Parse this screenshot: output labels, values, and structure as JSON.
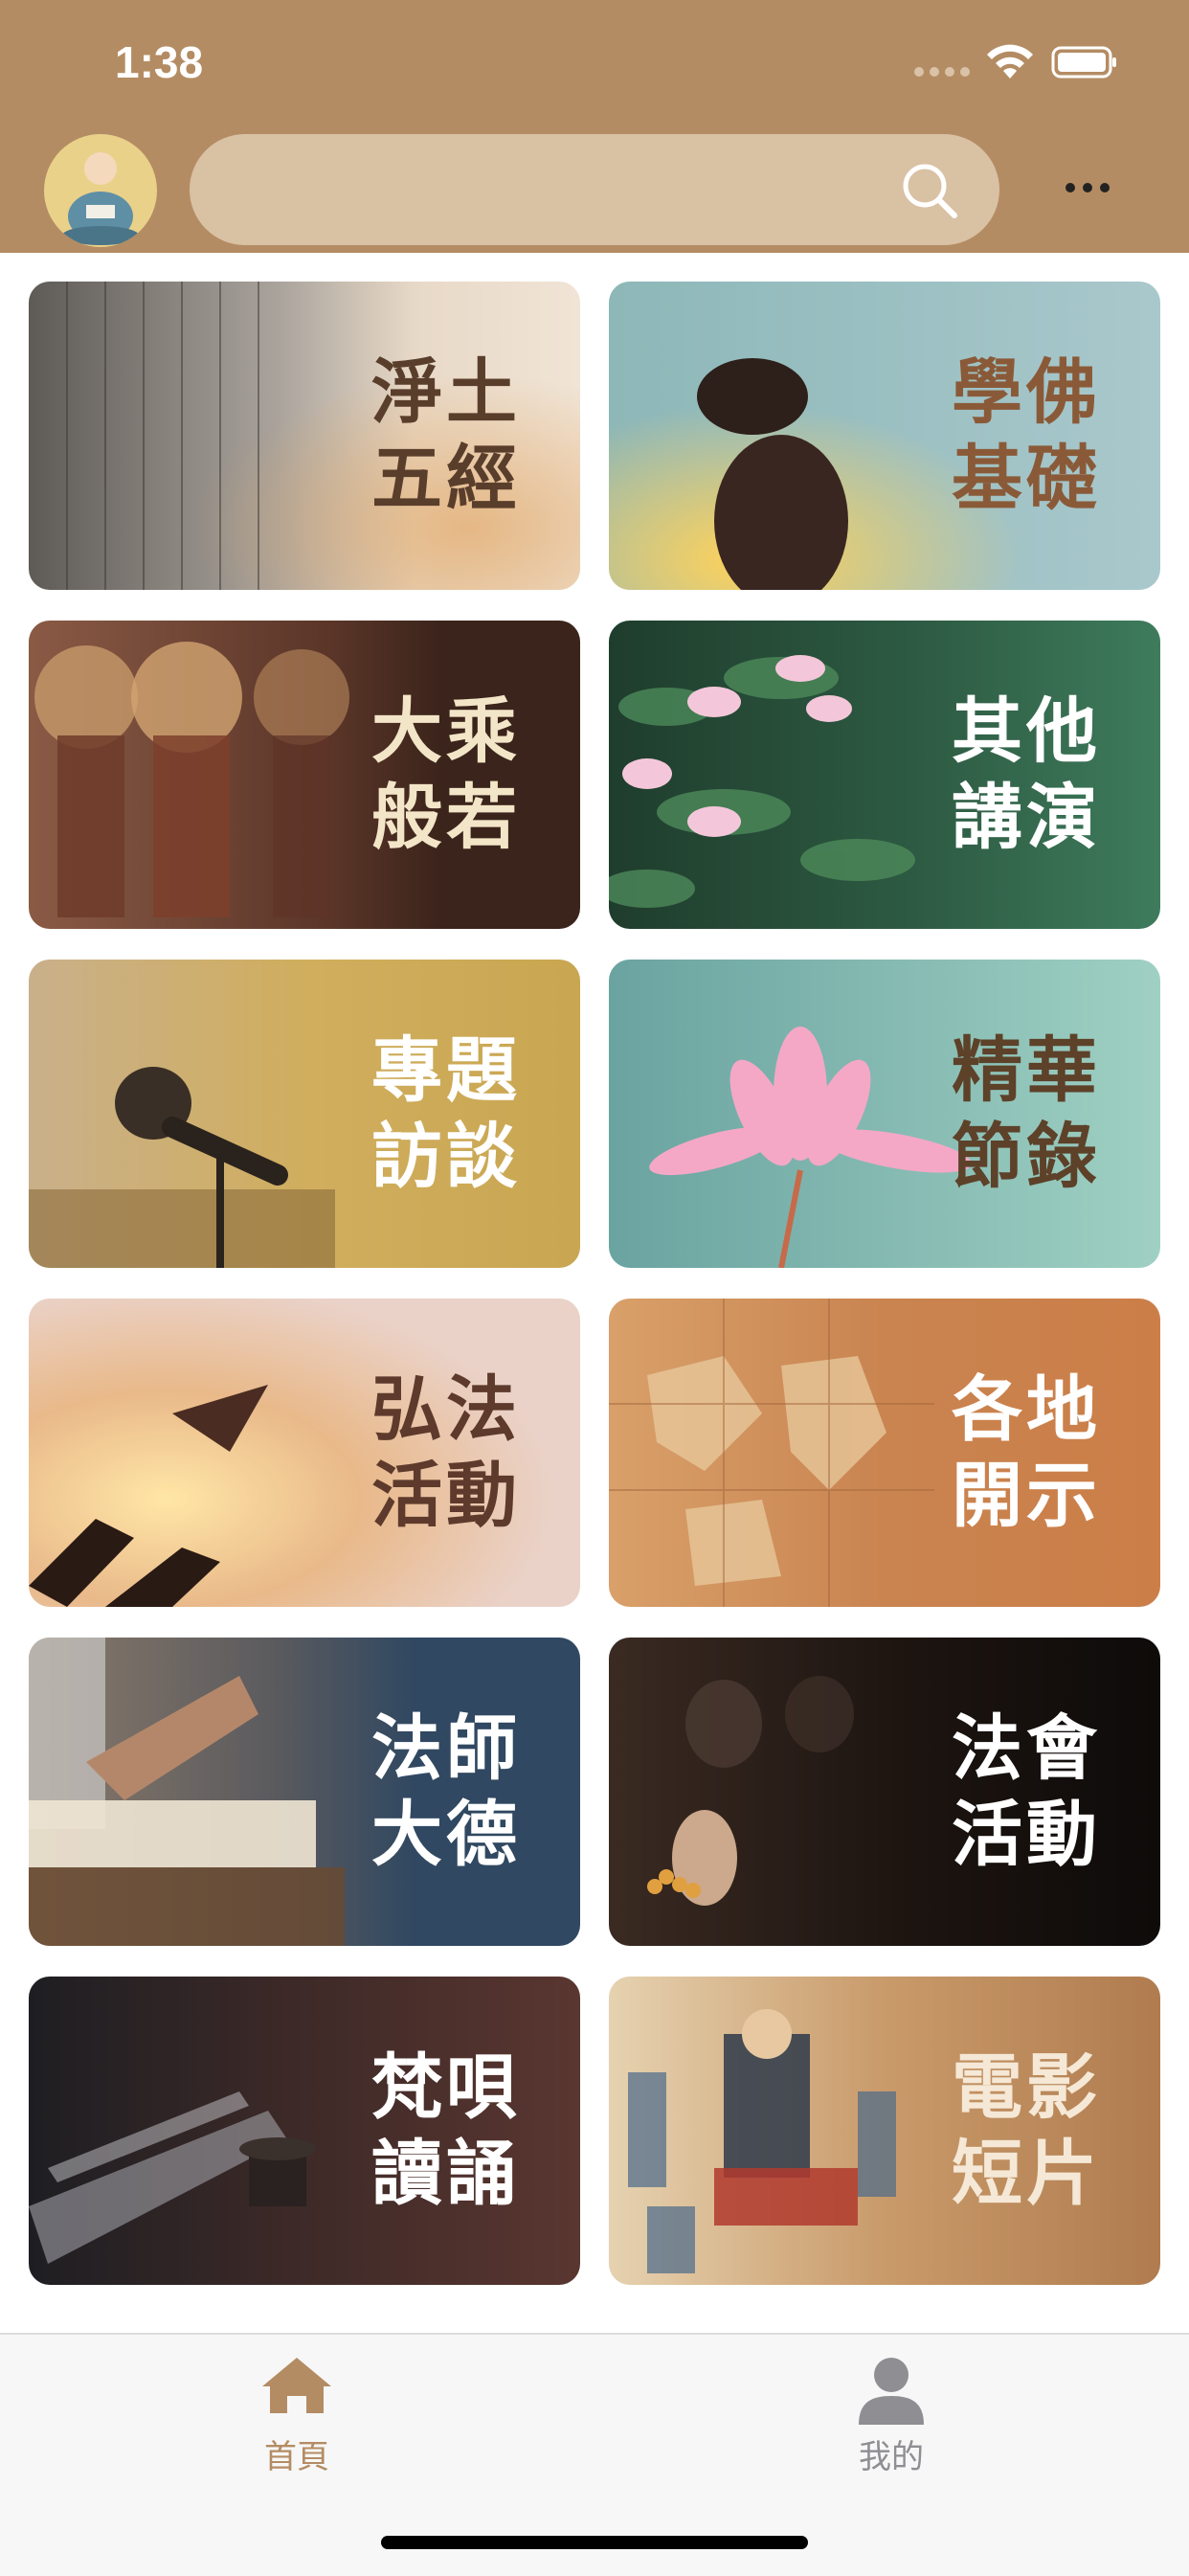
{
  "status_bar": {
    "time": "1:38"
  },
  "header": {
    "search_placeholder": ""
  },
  "tiles": [
    {
      "line1": "淨土",
      "line2": "五經",
      "bg": "#d9c6ad",
      "fg": "#5a3e2c"
    },
    {
      "line1": "學佛",
      "line2": "基礎",
      "bg": "#a9c8cc",
      "fg": "#8a5a38"
    },
    {
      "line1": "大乘",
      "line2": "般若",
      "bg": "#3b241b",
      "fg": "#f3e6c8"
    },
    {
      "line1": "其他",
      "line2": "講演",
      "bg": "#3e7b5c",
      "fg": "#ffffff"
    },
    {
      "line1": "專題",
      "line2": "訪談",
      "bg": "#c9a651",
      "fg": "#ffffff"
    },
    {
      "line1": "精華",
      "line2": "節錄",
      "bg": "#9fd0c3",
      "fg": "#5d4129"
    },
    {
      "line1": "弘法",
      "line2": "活動",
      "bg": "#ead2c8",
      "fg": "#5d3a2c"
    },
    {
      "line1": "各地",
      "line2": "開示",
      "bg": "#cc7e48",
      "fg": "#ffffff"
    },
    {
      "line1": "法師",
      "line2": "大德",
      "bg": "#304861",
      "fg": "#ffffff"
    },
    {
      "line1": "法會",
      "line2": "活動",
      "bg": "#0e0b0a",
      "fg": "#ffffff"
    },
    {
      "line1": "梵唄",
      "line2": "讀誦",
      "bg": "#5a3630",
      "fg": "#ffffff"
    },
    {
      "line1": "電影",
      "line2": "短片",
      "bg": "#b07c4f",
      "fg": "#f5e8d6"
    }
  ],
  "tabbar": {
    "home_label": "首頁",
    "me_label": "我的",
    "active_color": "#b48c63",
    "inactive_color": "#8e8e93"
  },
  "colors": {
    "header_bg": "#b48c63",
    "search_bg": "#d9c1a4",
    "avatar_bg": "#e9d18a"
  },
  "icons": [
    "wifi-icon",
    "battery-icon",
    "search-icon",
    "more-icon",
    "home-icon",
    "person-icon"
  ]
}
